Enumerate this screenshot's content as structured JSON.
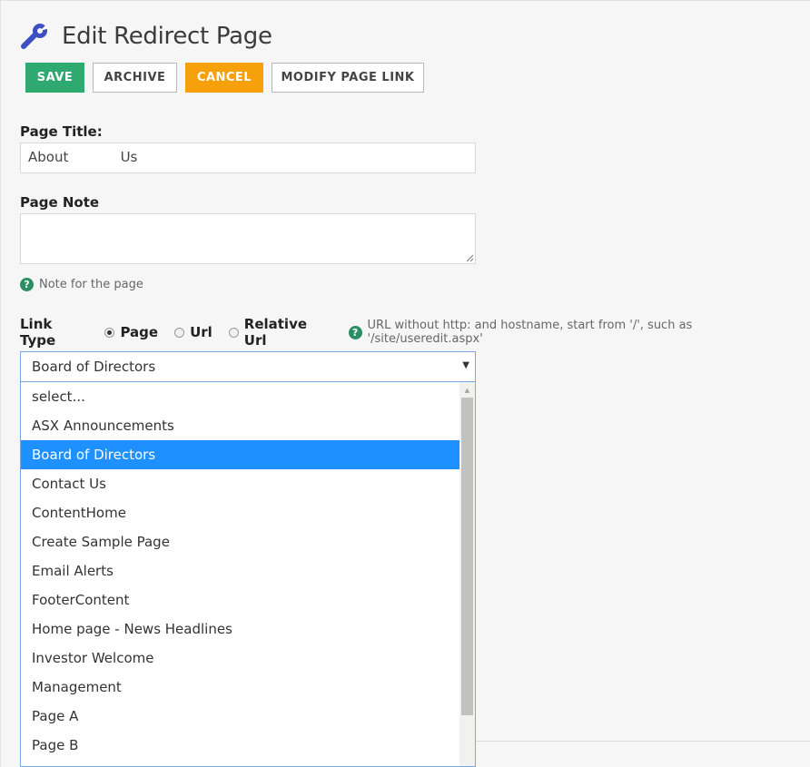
{
  "header": {
    "title": "Edit Redirect Page",
    "icon": "wrench-icon"
  },
  "toolbar": {
    "save_label": "SAVE",
    "archive_label": "ARCHIVE",
    "cancel_label": "CANCEL",
    "modify_label": "MODIFY PAGE LINK"
  },
  "colors": {
    "save": "#2eaa71",
    "cancel": "#f6a00b",
    "selected": "#1e90ff",
    "help": "#2a8f62"
  },
  "form": {
    "page_title_label": "Page Title:",
    "page_title_value": "About            Us",
    "page_note_label": "Page Note",
    "page_note_value": "",
    "page_note_help": "Note for the page",
    "help_glyph": "?",
    "link_type_label": "Link Type",
    "link_type_options": [
      "Page",
      "Url",
      "Relative Url"
    ],
    "link_type_selected": "Page",
    "link_type_help": "URL without http: and hostname, start from '/', such as '/site/useredit.aspx'"
  },
  "page_select": {
    "selected": "Board of Directors",
    "options": [
      "select...",
      "ASX Announcements",
      "Board of Directors",
      "Contact Us",
      "ContentHome",
      "Create Sample Page",
      "Email Alerts",
      "FooterContent",
      "Home page - News Headlines",
      "Investor Welcome",
      "Management",
      "Page A",
      "Page B"
    ]
  }
}
